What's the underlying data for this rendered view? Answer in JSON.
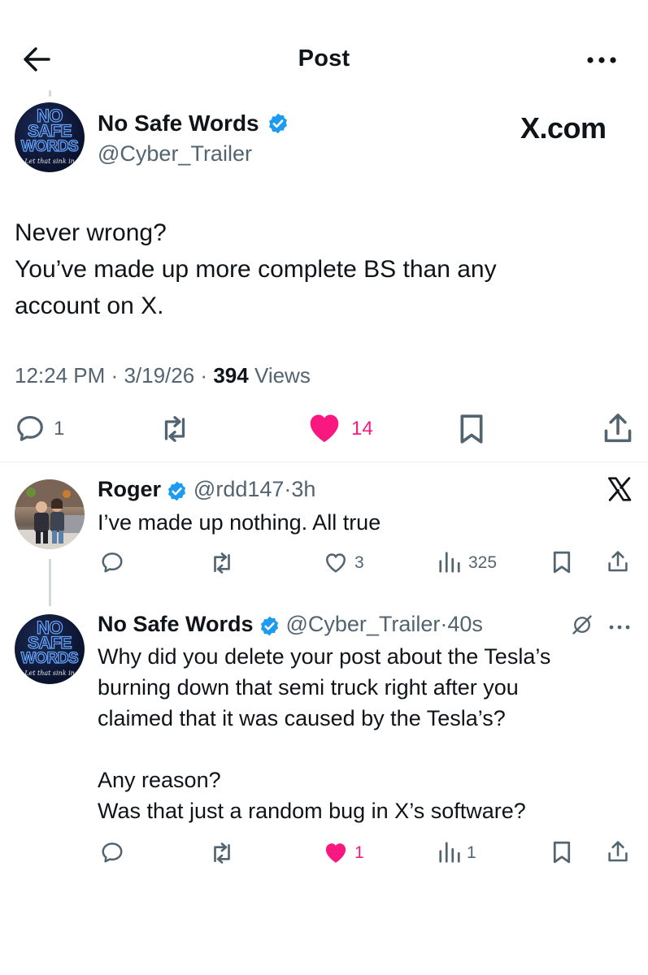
{
  "header": {
    "title": "Post",
    "back_icon": "arrow-left-icon",
    "more_icon": "more-horizontal-icon"
  },
  "colors": {
    "text": "#0f1419",
    "secondary": "#536471",
    "verified": "#1d9bf0",
    "like": "#f91880",
    "divider": "#eff3f4"
  },
  "avatar_nsw": {
    "line1": "NO",
    "line2": "SAFE",
    "line3": "WORDS",
    "tagline": "Let that sink in"
  },
  "main_post": {
    "display_name": "No Safe Words",
    "handle": "@Cyber_Trailer",
    "watermark": "X.com",
    "lines": [
      "Never wrong?",
      "You’ve made up more complete BS than any",
      "account on X."
    ],
    "time": "12:24 PM",
    "date": "3/19/26",
    "views_count": "394",
    "views_label": "Views",
    "sep": "·",
    "reply_count": "1",
    "like_count": "14"
  },
  "replies": [
    {
      "display_name": "Roger",
      "handle": "@rdd147",
      "time": "3h",
      "text": "I’ve made up nothing. All true",
      "like_count": "3",
      "view_count": "325"
    },
    {
      "display_name": "No Safe Words",
      "handle": "@Cyber_Trailer",
      "time": "40s",
      "lines": [
        "Why did you delete your post about the Tesla’s",
        "burning down that semi truck right after you",
        "claimed that it was caused by the Tesla’s?",
        "",
        "Any reason?",
        "Was that just a random bug in X’s software?"
      ],
      "like_count": "1",
      "view_count": "1"
    }
  ]
}
